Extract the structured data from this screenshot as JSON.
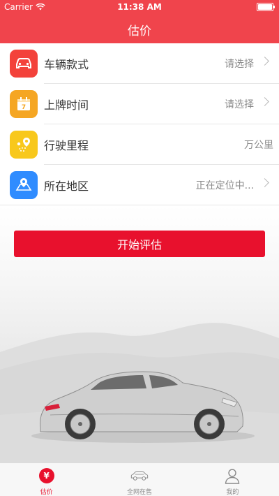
{
  "status_bar": {
    "carrier": "Carrier",
    "time": "11:38 AM",
    "battery_level": 1.0
  },
  "nav": {
    "title": "估价"
  },
  "form": {
    "rows": [
      {
        "label": "车辆款式",
        "value": "请选择",
        "icon": "car-icon",
        "icon_color": "#f3423b",
        "has_arrow": true
      },
      {
        "label": "上牌时间",
        "value": "请选择",
        "icon": "calendar-icon",
        "icon_color": "#f5a623",
        "has_arrow": true
      },
      {
        "label": "行驶里程",
        "value": "万公里",
        "icon": "route-pin-icon",
        "icon_color": "#f8c81c",
        "has_arrow": false
      },
      {
        "label": "所在地区",
        "value": "正在定位中...",
        "icon": "map-location-icon",
        "icon_color": "#2f8cff",
        "has_arrow": true
      }
    ]
  },
  "evaluate_button": {
    "label": "开始评估",
    "color": "#e8112d"
  },
  "tabbar": {
    "tabs": [
      {
        "label": "估价",
        "icon": "yen-coin-icon",
        "active": true,
        "glyph": "¥"
      },
      {
        "label": "全网在售",
        "icon": "car-outline-icon",
        "active": false
      },
      {
        "label": "我的",
        "icon": "user-icon",
        "active": false
      }
    ]
  },
  "colors": {
    "header": "#f0444c",
    "accent": "#e8112d"
  }
}
